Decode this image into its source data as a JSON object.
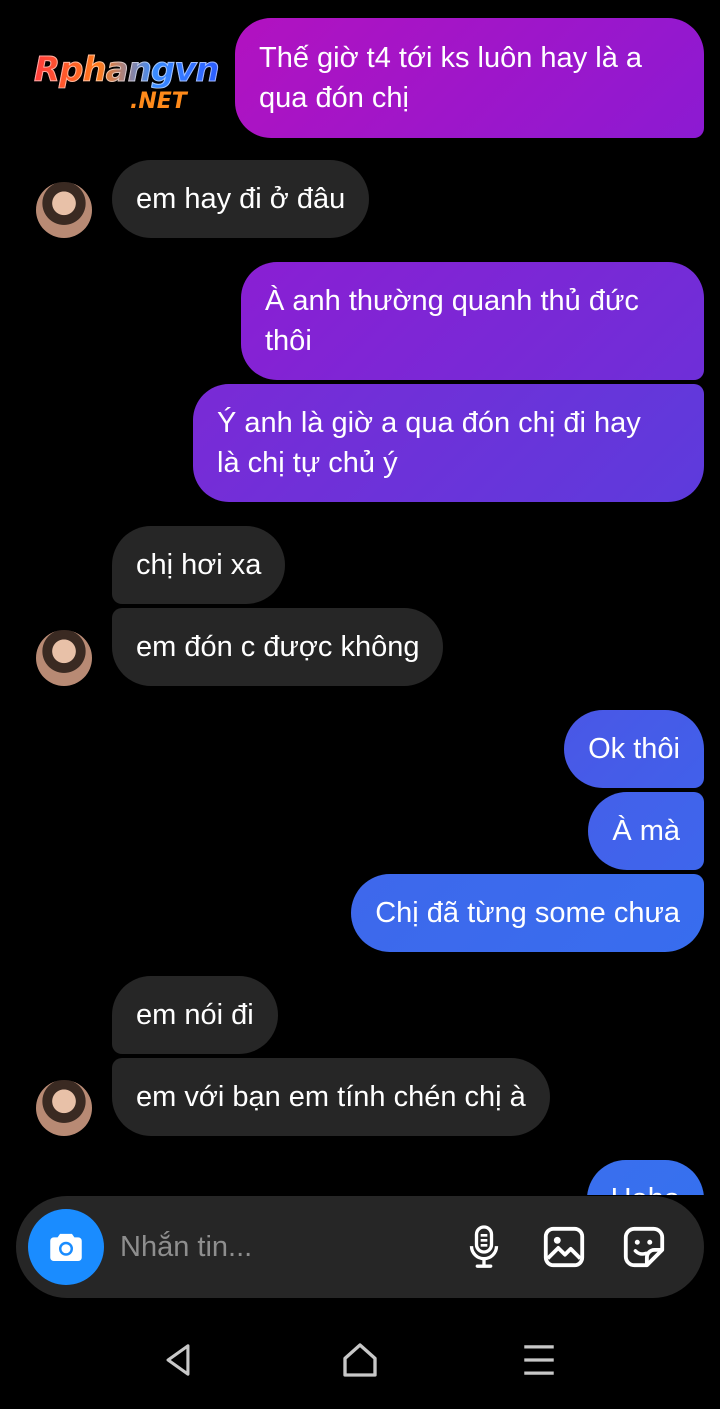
{
  "watermark": {
    "line1": "Rphangvn",
    "line2": ".NET"
  },
  "messages": [
    {
      "side": "out",
      "text": "Thế giờ t4 tới ks luôn hay là a\nqua đón chị"
    },
    {
      "side": "in",
      "text": "em hay đi ở đâu"
    },
    {
      "side": "out",
      "text": "À anh thường quanh thủ đức\nthôi"
    },
    {
      "side": "out",
      "text": "Ý anh là giờ a qua đón chị đi hay\nlà chị tự chủ ý"
    },
    {
      "side": "in",
      "text": "chị hơi xa"
    },
    {
      "side": "in",
      "text": "em đón c được không"
    },
    {
      "side": "out",
      "text": "Ok thôi"
    },
    {
      "side": "out",
      "text": "À mà"
    },
    {
      "side": "out",
      "text": "Chị đã từng some chưa"
    },
    {
      "side": "in",
      "text": "em nói đi"
    },
    {
      "side": "in",
      "text": "em với bạn em tính chén chị à"
    },
    {
      "side": "out",
      "text": "Haha"
    }
  ],
  "composer": {
    "placeholder": "Nhắn tin...",
    "icons": [
      "camera-icon",
      "microphone-icon",
      "image-gallery-icon",
      "sticker-icon"
    ]
  },
  "navbar": {
    "icons": [
      "back-icon",
      "home-icon",
      "menu-icon"
    ]
  },
  "colors": {
    "incoming_bubble": "#262626",
    "outgoing_gradient_top": "#9b15c9",
    "outgoing_gradient_mid": "#6a35d6",
    "outgoing_gradient_bottom": "#3a62ea",
    "camera_button": "#1a8cff"
  }
}
